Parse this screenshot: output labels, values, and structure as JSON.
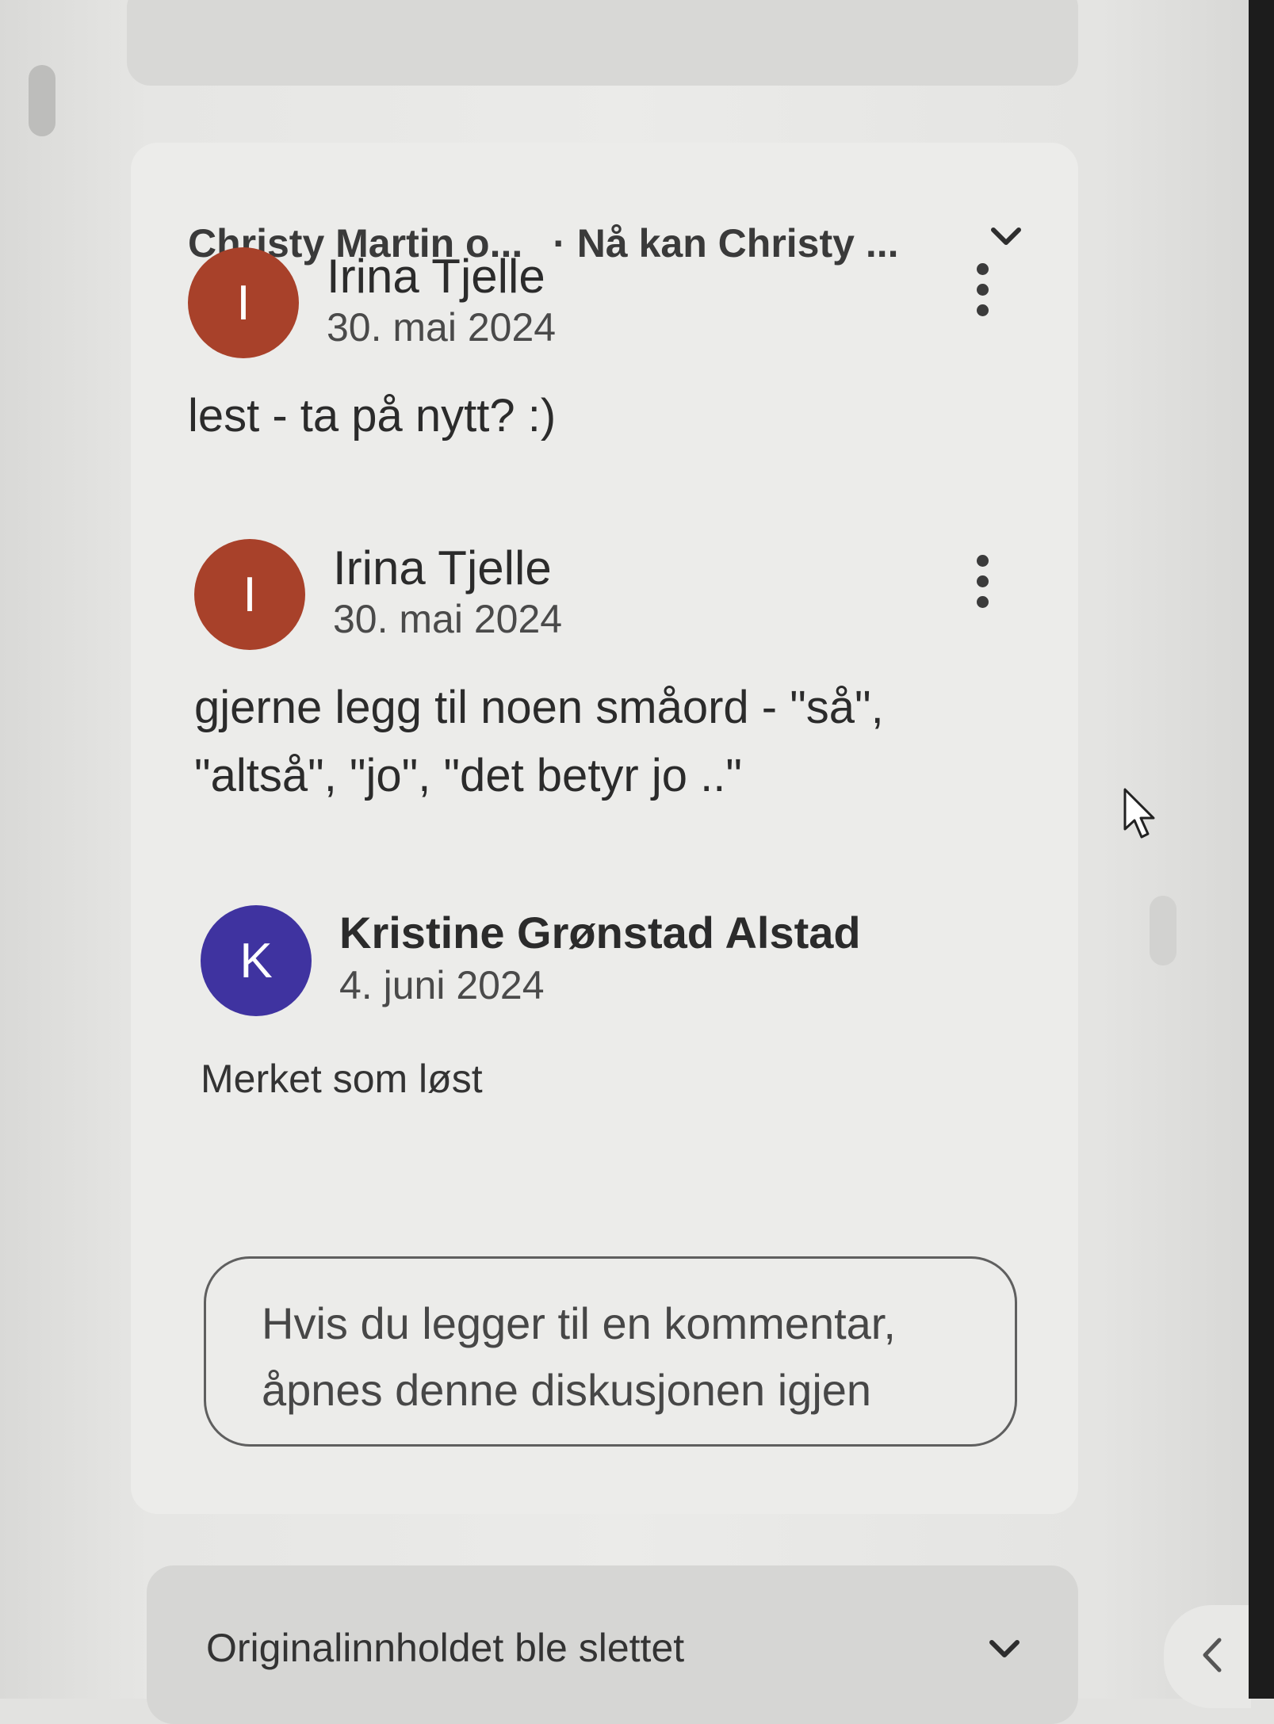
{
  "thread": {
    "title_part1": "Christy Martin o...",
    "title_part2": "· Nå kan Christy ...",
    "icons": {
      "collapse": "chevron-down-icon",
      "more": "more-vert-icon"
    }
  },
  "comments": [
    {
      "avatar_letter": "I",
      "avatar_color": "#a8412a",
      "author": "Irina Tjelle",
      "date": "30. mai 2024",
      "text_lines": [
        "lest - ta på nytt? :)"
      ]
    },
    {
      "avatar_letter": "I",
      "avatar_color": "#a8412a",
      "author": "Irina Tjelle",
      "date": "30. mai 2024",
      "text_lines": [
        "gjerne legg til noen småord - \"så\",",
        "\"altså\", \"jo\", \"det betyr jo ..\""
      ]
    },
    {
      "avatar_letter": "K",
      "avatar_color": "#3f33a0",
      "author": "Kristine Grønstad Alstad",
      "date": "4. juni 2024",
      "status": "Merket som løst"
    }
  ],
  "reply": {
    "placeholder_lines": [
      "Hvis du legger til en kommentar,",
      "åpnes denne diskusjonen igjen"
    ]
  },
  "next_thread": {
    "title": "Originalinnholdet ble slettet"
  },
  "side_panel": {
    "toggle_icon": "chevron-left-icon"
  }
}
